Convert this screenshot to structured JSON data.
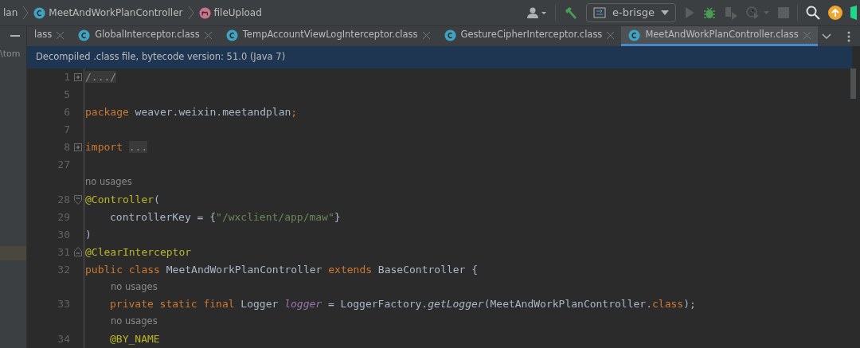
{
  "breadcrumbs": [
    {
      "label": "lan",
      "kind": "package"
    },
    {
      "label": "MeetAndWorkPlanController",
      "kind": "class"
    },
    {
      "label": "fileUpload",
      "kind": "method"
    }
  ],
  "run_config": {
    "label": "e-brisge"
  },
  "left_panel": {
    "path": "\\tom"
  },
  "tabs": [
    {
      "label": "lass",
      "selected": false,
      "kind": "partial"
    },
    {
      "label": "GlobalInterceptor.class",
      "selected": false,
      "kind": "class"
    },
    {
      "label": "TempAccountViewLogInterceptor.class",
      "selected": false,
      "kind": "class"
    },
    {
      "label": "GestureCipherInterceptor.class",
      "selected": false,
      "kind": "class"
    },
    {
      "label": "MeetAndWorkPlanController.class",
      "selected": true,
      "kind": "class"
    }
  ],
  "banner": "Decompiled .class file, bytecode version: 51.0 (Java 7)",
  "lines": [
    {
      "kind": "code",
      "number": "1",
      "expanded": false,
      "tokens": [
        {
          "t": "/.../",
          "kind": "folded"
        }
      ]
    },
    {
      "kind": "code",
      "number": "5"
    },
    {
      "kind": "code",
      "number": "6",
      "tokens": [
        {
          "t": "package",
          "kind": "keyword"
        },
        {
          "t": " weaver.weixin.meetandplan",
          "kind": "plain"
        },
        {
          "t": ";",
          "kind": "keyword"
        }
      ]
    },
    {
      "kind": "code",
      "number": "7"
    },
    {
      "kind": "code",
      "number": "8",
      "expanded": false,
      "tokens": [
        {
          "t": "import",
          "kind": "keyword"
        },
        {
          "t": "...",
          "kind": "folded"
        }
      ]
    },
    {
      "kind": "code",
      "number": "27"
    },
    {
      "kind": "hint",
      "text": "no usages"
    },
    {
      "kind": "code",
      "number": "28",
      "expanded": true,
      "tokens": [
        {
          "t": "@Controller",
          "kind": "annotation"
        },
        {
          "t": "(",
          "kind": "plain"
        }
      ]
    },
    {
      "kind": "body",
      "number": "29",
      "tokens": [
        {
          "t": "controllerKey = {",
          "kind": "plain"
        },
        {
          "t": "\"/wxclient/app/maw\"",
          "kind": "string"
        },
        {
          "t": "}",
          "kind": "plain"
        }
      ]
    },
    {
      "kind": "code",
      "number": "30",
      "tokens": [
        {
          "t": ")",
          "kind": "plain"
        }
      ]
    },
    {
      "kind": "code",
      "number": "31",
      "expanded": true,
      "fold_end": true,
      "tokens": [
        {
          "t": "@ClearInterceptor",
          "kind": "annotation"
        }
      ]
    },
    {
      "kind": "code",
      "number": "32",
      "tokens": [
        {
          "t": "public class",
          "kind": "keyword"
        },
        {
          "t": " MeetAndWorkPlanController ",
          "kind": "plain"
        },
        {
          "t": "extends",
          "kind": "keyword"
        },
        {
          "t": " BaseController {",
          "kind": "plain"
        }
      ]
    },
    {
      "kind": "body-hint",
      "text": "no usages"
    },
    {
      "kind": "body",
      "number": "33",
      "tokens": [
        {
          "t": "private static final",
          "kind": "keyword"
        },
        {
          "t": " Logger ",
          "kind": "plain"
        },
        {
          "t": "logger",
          "kind": "field"
        },
        {
          "t": " = LoggerFactory.",
          "kind": "plain"
        },
        {
          "t": "getLogger",
          "kind": "method"
        },
        {
          "t": "(MeetAndWorkPlanController.",
          "kind": "plain"
        },
        {
          "t": "class",
          "kind": "keyword"
        },
        {
          "t": ");",
          "kind": "plain"
        }
      ]
    },
    {
      "kind": "body-hint",
      "text": "no usages"
    },
    {
      "kind": "body",
      "number": "34",
      "tokens": [
        {
          "t": "@BY_NAME",
          "kind": "annotation"
        }
      ]
    }
  ]
}
